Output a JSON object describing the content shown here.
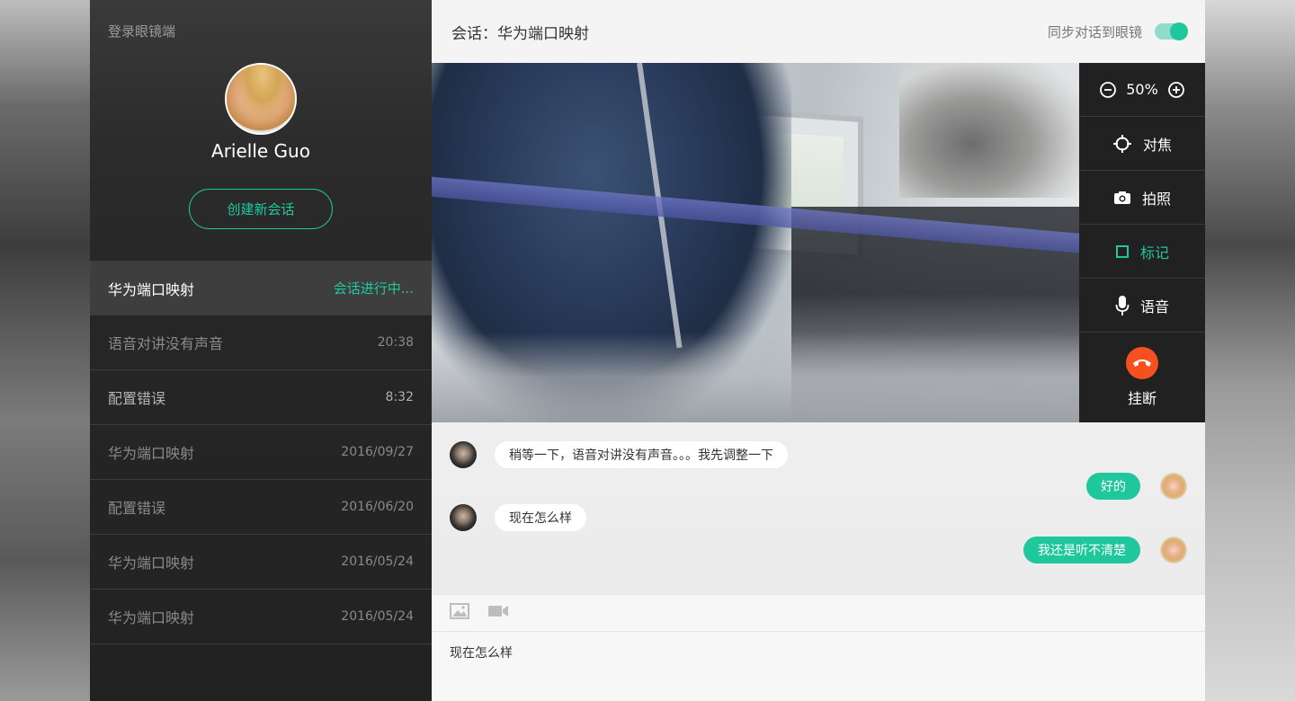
{
  "colors": {
    "accent": "#1ec89c",
    "hangup": "#f4511e",
    "sidebar_bg": "#262626",
    "control_bg": "#212121"
  },
  "sidebar": {
    "login_label": "登录眼镜端",
    "user_name": "Arielle Guo",
    "new_session_label": "创建新会话",
    "sessions": [
      {
        "title": "华为端口映射",
        "time": "会话进行中...",
        "state": "active"
      },
      {
        "title": "语音对讲没有声音",
        "time": "20:38",
        "state": "dim"
      },
      {
        "title": "配置错误",
        "time": "8:32",
        "state": "normal"
      },
      {
        "title": "华为端口映射",
        "time": "2016/09/27",
        "state": "dim"
      },
      {
        "title": "配置错误",
        "time": "2016/06/20",
        "state": "dim"
      },
      {
        "title": "华为端口映射",
        "time": "2016/05/24",
        "state": "dim"
      },
      {
        "title": "华为端口映射",
        "time": "2016/05/24",
        "state": "dim"
      }
    ]
  },
  "header": {
    "title": "会话：华为端口映射",
    "sync_label": "同步对话到眼镜",
    "sync_on": true
  },
  "controls": {
    "zoom_value": "50%",
    "focus_label": "对焦",
    "photo_label": "拍照",
    "mark_label": "标记",
    "voice_label": "语音",
    "hangup_label": "挂断"
  },
  "chat": {
    "messages": [
      {
        "from": "remote",
        "text": "稍等一下，语音对讲没有声音。。。我先调整一下"
      },
      {
        "from": "self",
        "text": "好的"
      },
      {
        "from": "remote",
        "text": "现在怎么样"
      },
      {
        "from": "self",
        "text": "我还是听不清楚"
      }
    ]
  },
  "composer": {
    "value": "现在怎么样"
  },
  "icons": {
    "zoom_out": "minus-circle-icon",
    "zoom_in": "plus-circle-icon",
    "focus": "crosshair-icon",
    "photo": "camera-icon",
    "mark": "square-icon",
    "voice": "microphone-icon",
    "hangup": "phone-hangup-icon",
    "image": "image-icon",
    "video": "video-camera-icon"
  }
}
